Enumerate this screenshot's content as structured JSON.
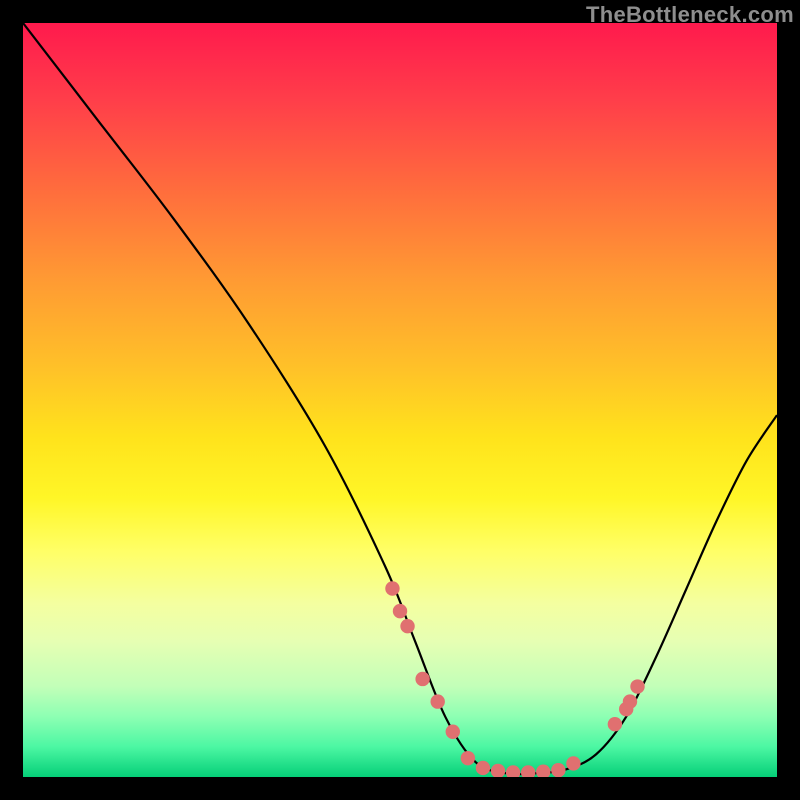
{
  "attribution": "TheBottleneck.com",
  "chart_data": {
    "type": "line",
    "title": "",
    "xlabel": "",
    "ylabel": "",
    "xlim": [
      0,
      100
    ],
    "ylim": [
      0,
      100
    ],
    "series": [
      {
        "name": "bottleneck-curve",
        "x": [
          0,
          10,
          20,
          30,
          40,
          48,
          52,
          56,
          60,
          64,
          68,
          72,
          76,
          80,
          84,
          88,
          92,
          96,
          100
        ],
        "y": [
          100,
          87,
          74,
          60,
          44,
          28,
          18,
          8,
          2,
          0.5,
          0.5,
          1,
          3,
          8,
          16,
          25,
          34,
          42,
          48
        ]
      }
    ],
    "markers": {
      "name": "highlight-points",
      "color": "#e07070",
      "x": [
        49,
        50,
        51,
        53,
        55,
        57,
        59,
        61,
        63,
        65,
        67,
        69,
        71,
        73,
        78.5,
        80,
        80.5,
        81.5
      ],
      "y": [
        25,
        22,
        20,
        13,
        10,
        6,
        2.5,
        1.2,
        0.8,
        0.6,
        0.6,
        0.7,
        0.9,
        1.8,
        7,
        9,
        10,
        12
      ]
    }
  }
}
